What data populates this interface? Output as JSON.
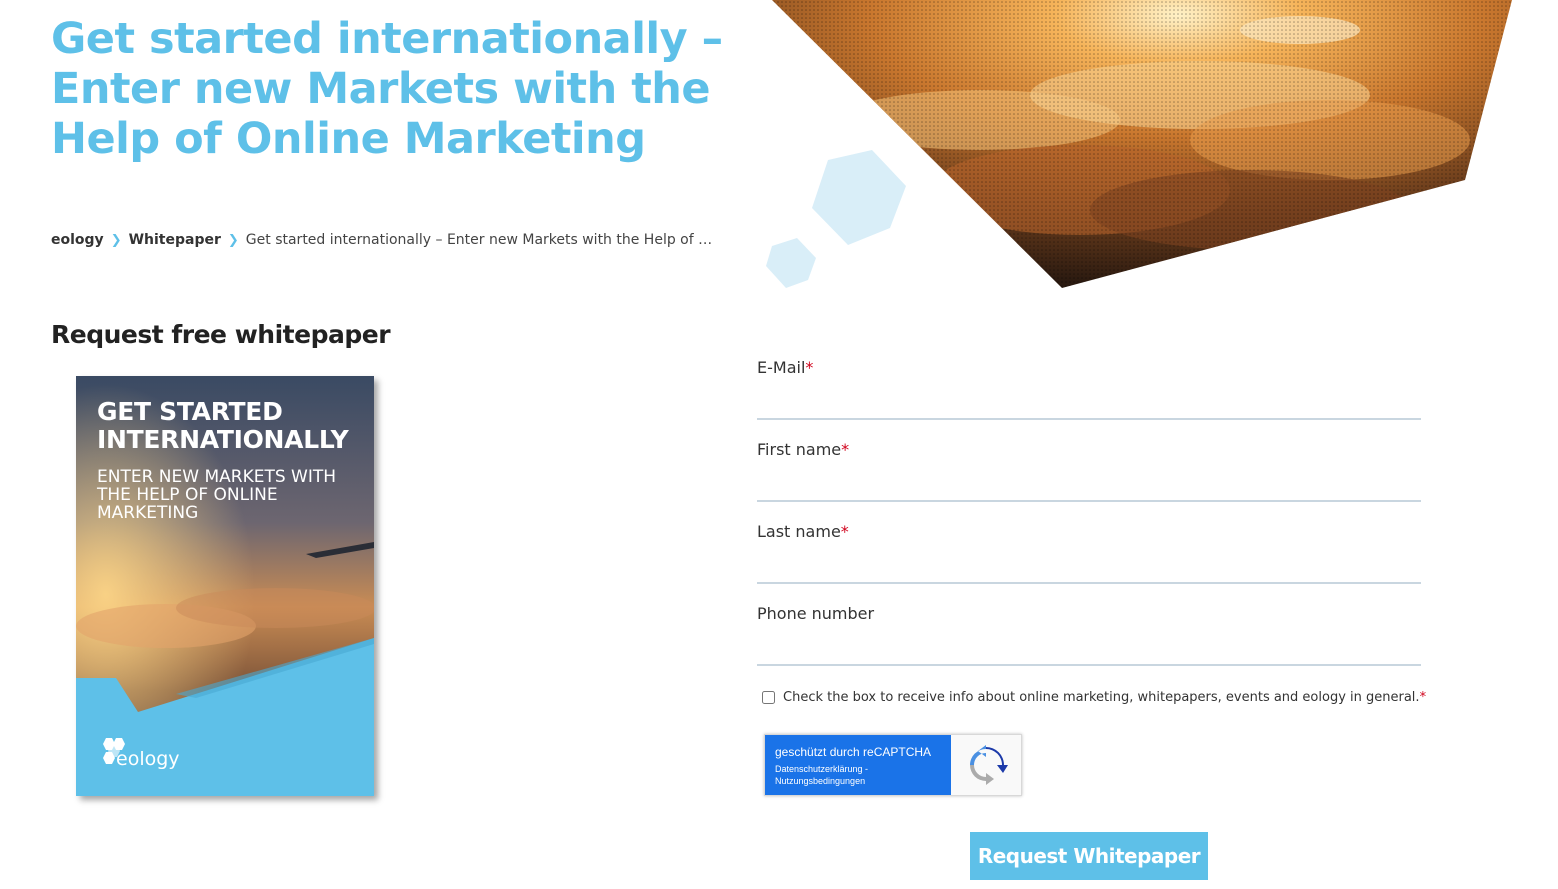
{
  "hero": {
    "title": "Get started internationally – Enter new Markets with the Help of Online Marketing"
  },
  "breadcrumb": {
    "items": [
      {
        "label": "eology"
      },
      {
        "label": "Whitepaper"
      }
    ],
    "current": "Get started internationally – Enter new Markets with the Help of Online Marketing"
  },
  "section": {
    "title": "Request free whitepaper"
  },
  "cover": {
    "title": "GET STARTED INTERNATIONALLY",
    "subtitle": "ENTER NEW MARKETS WITH THE HELP OF ONLINE MARKETING",
    "logo_text": "eology"
  },
  "form": {
    "fields": [
      {
        "label": "E-Mail",
        "required": "*",
        "value": ""
      },
      {
        "label": "First name",
        "required": "*",
        "value": ""
      },
      {
        "label": "Last name",
        "required": "*",
        "value": ""
      },
      {
        "label": "Phone number",
        "required": "",
        "value": ""
      }
    ],
    "consent": {
      "text": "Check the box to receive info about online marketing, whitepapers, events and eology in general.",
      "required": "*"
    },
    "recaptcha": {
      "title": "geschützt durch reCAPTCHA",
      "links": "Datenschutzerklärung - Nutzungsbedingungen"
    },
    "submit_label": "Request Whitepaper"
  },
  "colors": {
    "accent": "#5ec0e8",
    "required": "#d0021b",
    "recaptcha_blue": "#1a73e8"
  }
}
